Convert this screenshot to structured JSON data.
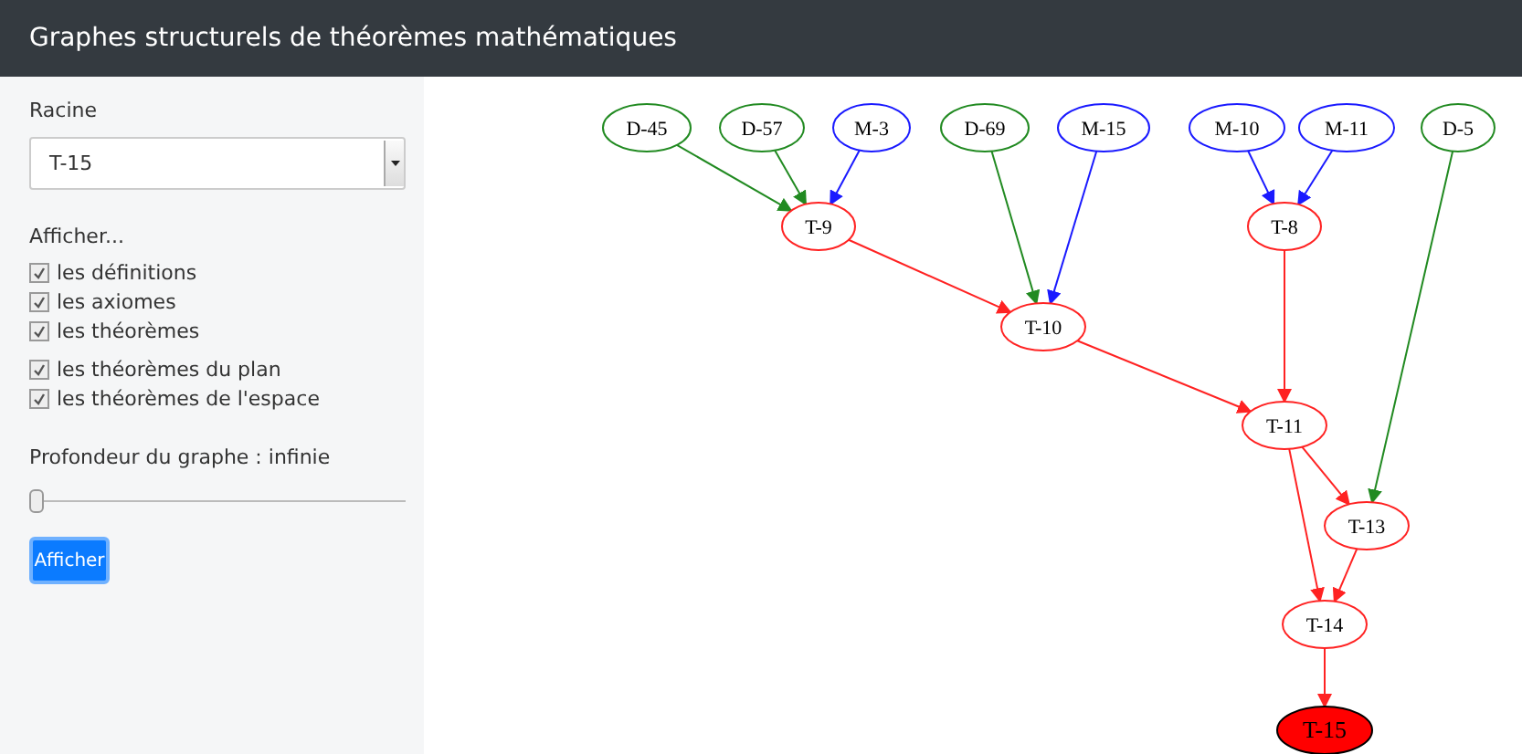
{
  "header": {
    "title": "Graphes structurels de théorèmes mathématiques"
  },
  "sidebar": {
    "root_label": "Racine",
    "root_select": {
      "value": "T-15"
    },
    "show_label": "Afficher...",
    "filter_groups": [
      [
        {
          "label": "les définitions",
          "checked": true
        },
        {
          "label": "les axiomes",
          "checked": true
        },
        {
          "label": "les théorèmes",
          "checked": true
        }
      ],
      [
        {
          "label": "les théorèmes du plan",
          "checked": true
        },
        {
          "label": "les théorèmes de l'espace",
          "checked": true
        }
      ]
    ],
    "depth": {
      "label": "Profondeur du graphe : infinie",
      "level": 0
    },
    "button": "Afficher"
  },
  "graph": {
    "nodes": [
      {
        "label": "D-45",
        "kind": "definition"
      },
      {
        "label": "D-57",
        "kind": "definition"
      },
      {
        "label": "M-3",
        "kind": "axiom"
      },
      {
        "label": "D-69",
        "kind": "definition"
      },
      {
        "label": "M-15",
        "kind": "axiom"
      },
      {
        "label": "M-10",
        "kind": "axiom"
      },
      {
        "label": "M-11",
        "kind": "axiom"
      },
      {
        "label": "D-5",
        "kind": "definition"
      },
      {
        "label": "T-9",
        "kind": "theorem"
      },
      {
        "label": "T-8",
        "kind": "theorem"
      },
      {
        "label": "T-10",
        "kind": "theorem"
      },
      {
        "label": "T-11",
        "kind": "theorem"
      },
      {
        "label": "T-13",
        "kind": "theorem"
      },
      {
        "label": "T-14",
        "kind": "theorem"
      },
      {
        "label": "T-15",
        "kind": "root"
      }
    ]
  }
}
